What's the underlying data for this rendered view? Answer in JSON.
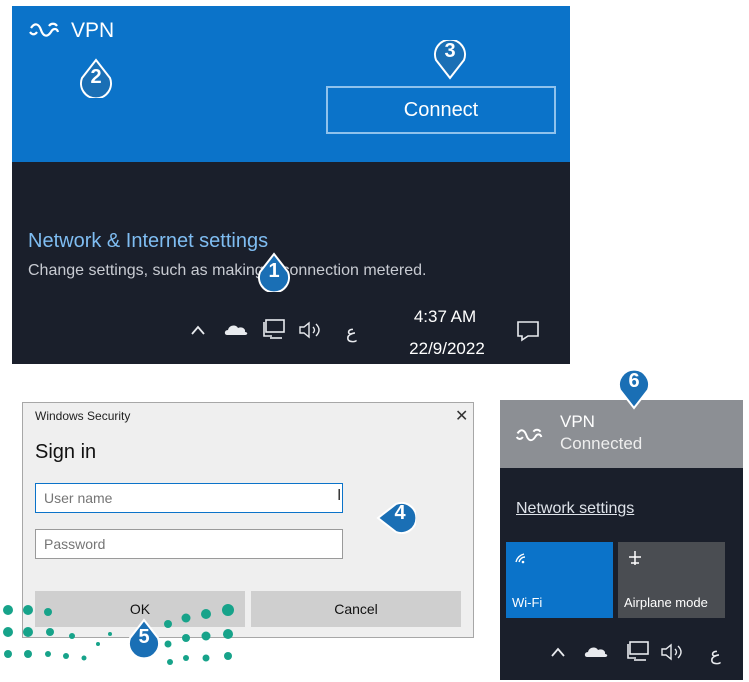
{
  "flyout_vpn": {
    "vpn_name": "VPN",
    "connect_label": "Connect",
    "network_settings_title": "Network & Internet settings",
    "network_settings_subtitle": "Change settings, such as making a connection metered."
  },
  "taskbar": {
    "input_indicator": "ع",
    "time": "4:37 AM",
    "date": "22/9/2022"
  },
  "dialog": {
    "window_title": "Windows Security",
    "heading": "Sign in",
    "username_placeholder": "User name",
    "password_placeholder": "Password",
    "ok_label": "OK",
    "cancel_label": "Cancel",
    "close_glyph": "✕"
  },
  "flyout_connected": {
    "vpn_name": "VPN",
    "status": "Connected",
    "network_settings_link": "Network settings",
    "wifi_label": "Wi-Fi",
    "airplane_label": "Airplane mode",
    "input_indicator": "ع"
  },
  "markers": [
    "1",
    "2",
    "3",
    "4",
    "5",
    "6"
  ],
  "colors": {
    "accent_blue": "#0b73c9",
    "marker_blue": "#1a6fb5",
    "dark_bg": "#1a1f2b",
    "logo_green": "#17a38a"
  }
}
